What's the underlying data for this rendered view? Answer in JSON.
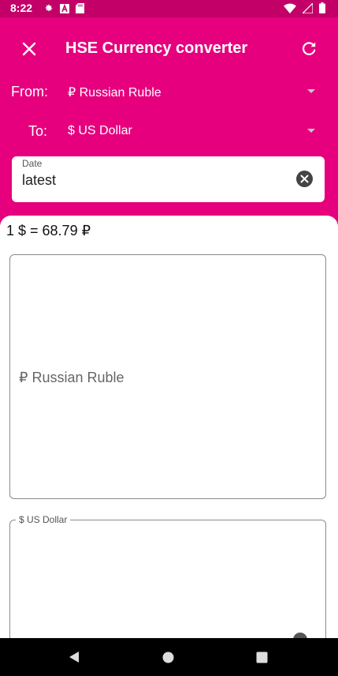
{
  "status": {
    "time": "8:22",
    "icons_left": [
      "settings-icon",
      "a-icon",
      "sd-card-icon"
    ],
    "icons_right": [
      "wifi-icon",
      "signal-icon",
      "battery-icon"
    ]
  },
  "appbar": {
    "title": "HSE Currency converter"
  },
  "from": {
    "label": "From:",
    "value": "₽ Russian Ruble"
  },
  "to": {
    "label": "To:",
    "value": "$ US Dollar"
  },
  "date": {
    "label": "Date",
    "value": "latest"
  },
  "rate": "1 $ = 68.79 ₽",
  "input_from": {
    "placeholder": "₽ Russian Ruble"
  },
  "input_to": {
    "label": "$ US Dollar"
  },
  "colors": {
    "primary": "#e6007e",
    "status_bar": "#c20068",
    "surface": "#ffffff"
  }
}
